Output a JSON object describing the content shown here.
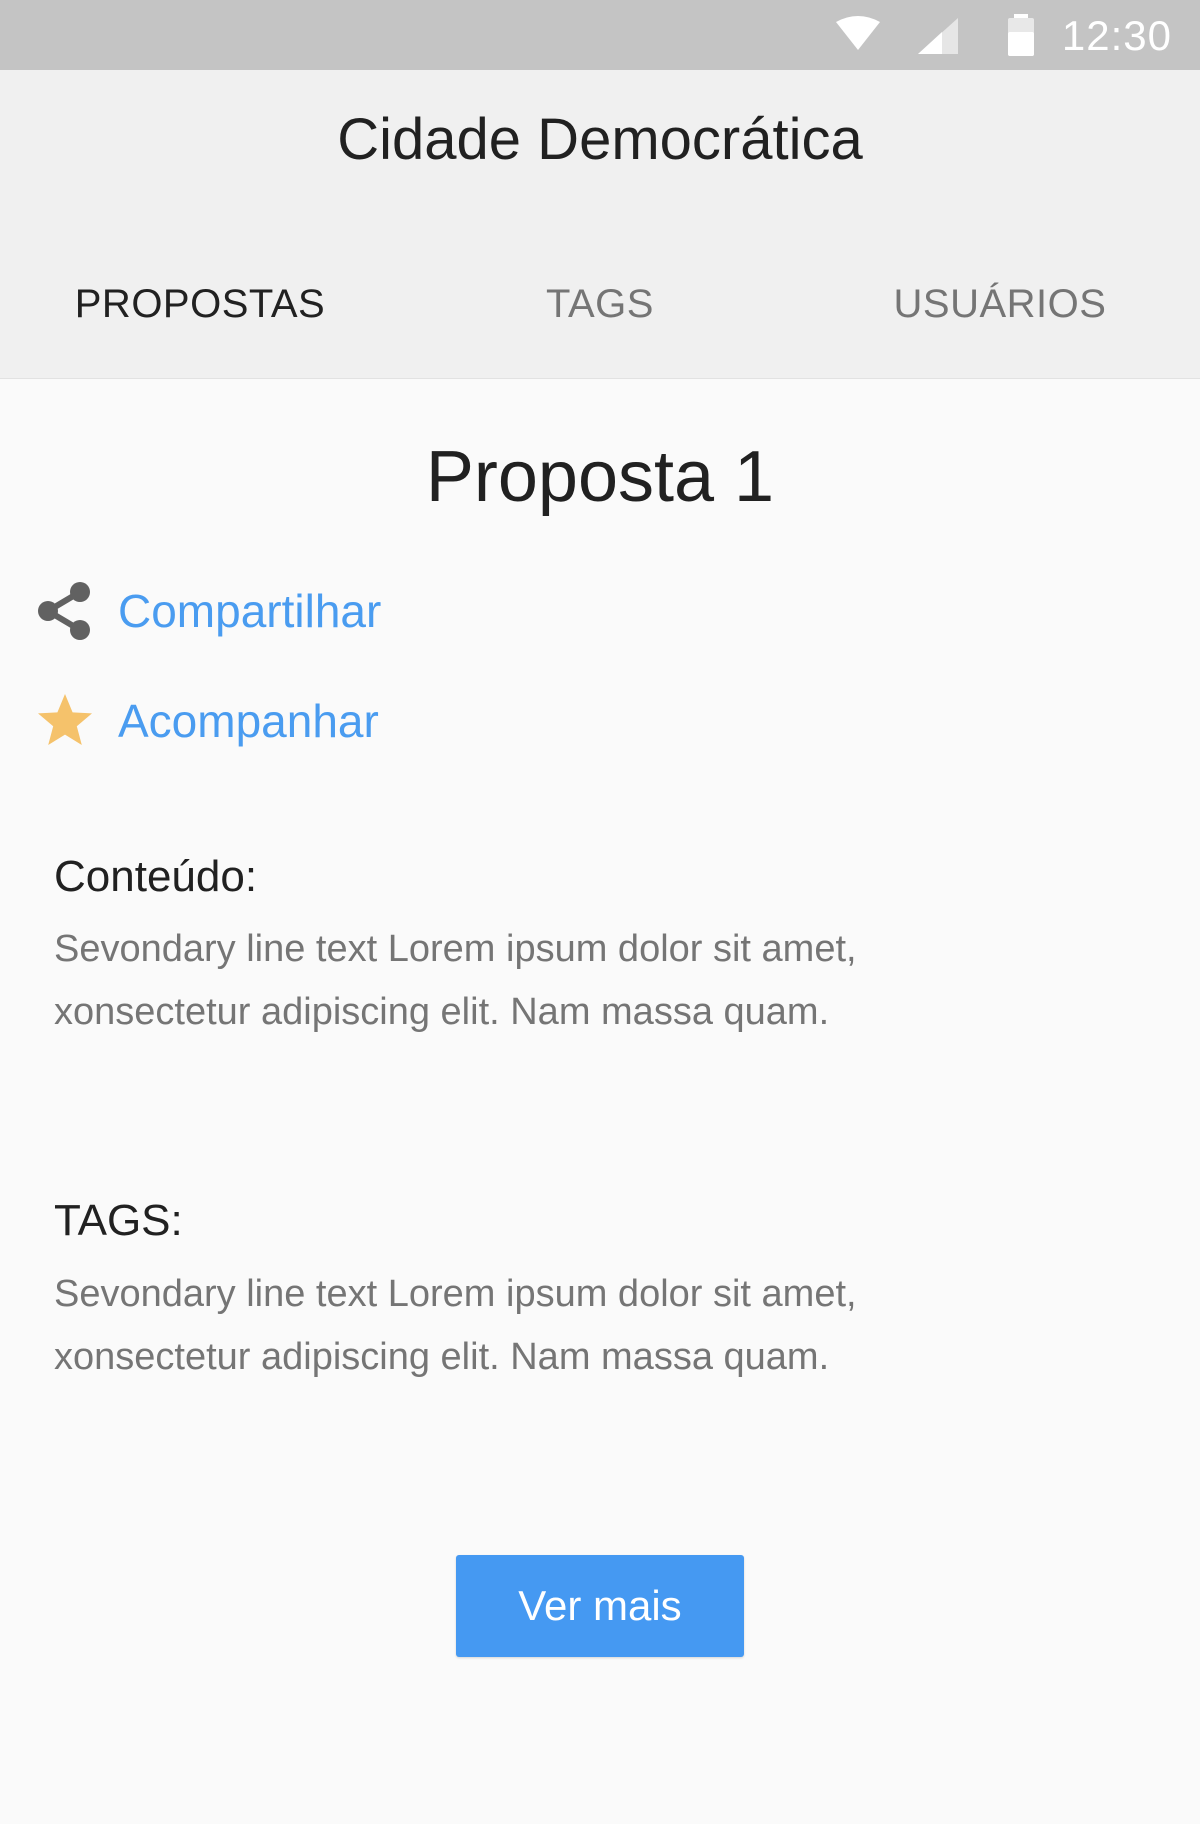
{
  "status_bar": {
    "time": "12:30",
    "icons": [
      "wifi-icon",
      "cellular-signal-icon",
      "battery-icon"
    ]
  },
  "app_bar": {
    "title": "Cidade Democrática",
    "tabs": [
      {
        "label": "PROPOSTAS",
        "active": true
      },
      {
        "label": "TAGS",
        "active": false
      },
      {
        "label": "USUÁRIOS",
        "active": false
      }
    ]
  },
  "proposal": {
    "title": "Proposta 1",
    "actions": {
      "share": {
        "label": "Compartilhar",
        "icon": "share-icon"
      },
      "follow": {
        "label": "Acompanhar",
        "icon": "star-icon"
      }
    },
    "content": {
      "label": "Conteúdo:",
      "text": "Sevondary line text Lorem ipsum dolor sit amet, xonsectetur adipiscing elit. Nam massa quam."
    },
    "tags": {
      "label": "TAGS:",
      "text": "Sevondary line text Lorem ipsum dolor sit amet, xonsectetur adipiscing elit. Nam massa quam."
    },
    "more_button": "Ver mais"
  },
  "colors": {
    "status_bar": "#c4c4c4",
    "app_bar": "#f0f0f0",
    "background": "#fafafa",
    "link": "#4a9cf0",
    "star": "#f5c26b",
    "button": "#4599f2"
  }
}
